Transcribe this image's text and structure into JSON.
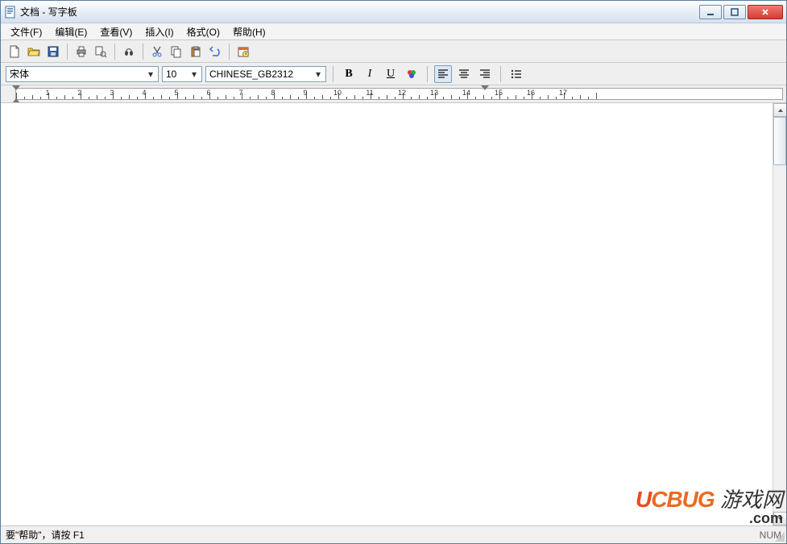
{
  "window": {
    "title": "文档 - 写字板"
  },
  "menu": {
    "items": [
      "文件(F)",
      "编辑(E)",
      "查看(V)",
      "插入(I)",
      "格式(O)",
      "帮助(H)"
    ]
  },
  "toolbar": {
    "icons": [
      "new",
      "open",
      "save",
      "print",
      "print-preview",
      "find",
      "cut",
      "copy",
      "paste",
      "undo",
      "date-time"
    ]
  },
  "format": {
    "font_name": "宋体",
    "font_size": "10",
    "charset": "CHINESE_GB2312",
    "bold": "B",
    "italic": "I",
    "underline": "U"
  },
  "ruler": {
    "numbers": [
      "1",
      "2",
      "3",
      "4",
      "5",
      "6",
      "7",
      "8",
      "9",
      "10",
      "11",
      "12",
      "13",
      "14",
      "15",
      "16",
      "17"
    ]
  },
  "statusbar": {
    "help_text": "要\"帮助\"，请按 F1",
    "num": "NUM"
  },
  "watermark": {
    "brand_u": "U",
    "brand_rest": "CBUG",
    "cn": "游戏网",
    "domain": ".com"
  }
}
